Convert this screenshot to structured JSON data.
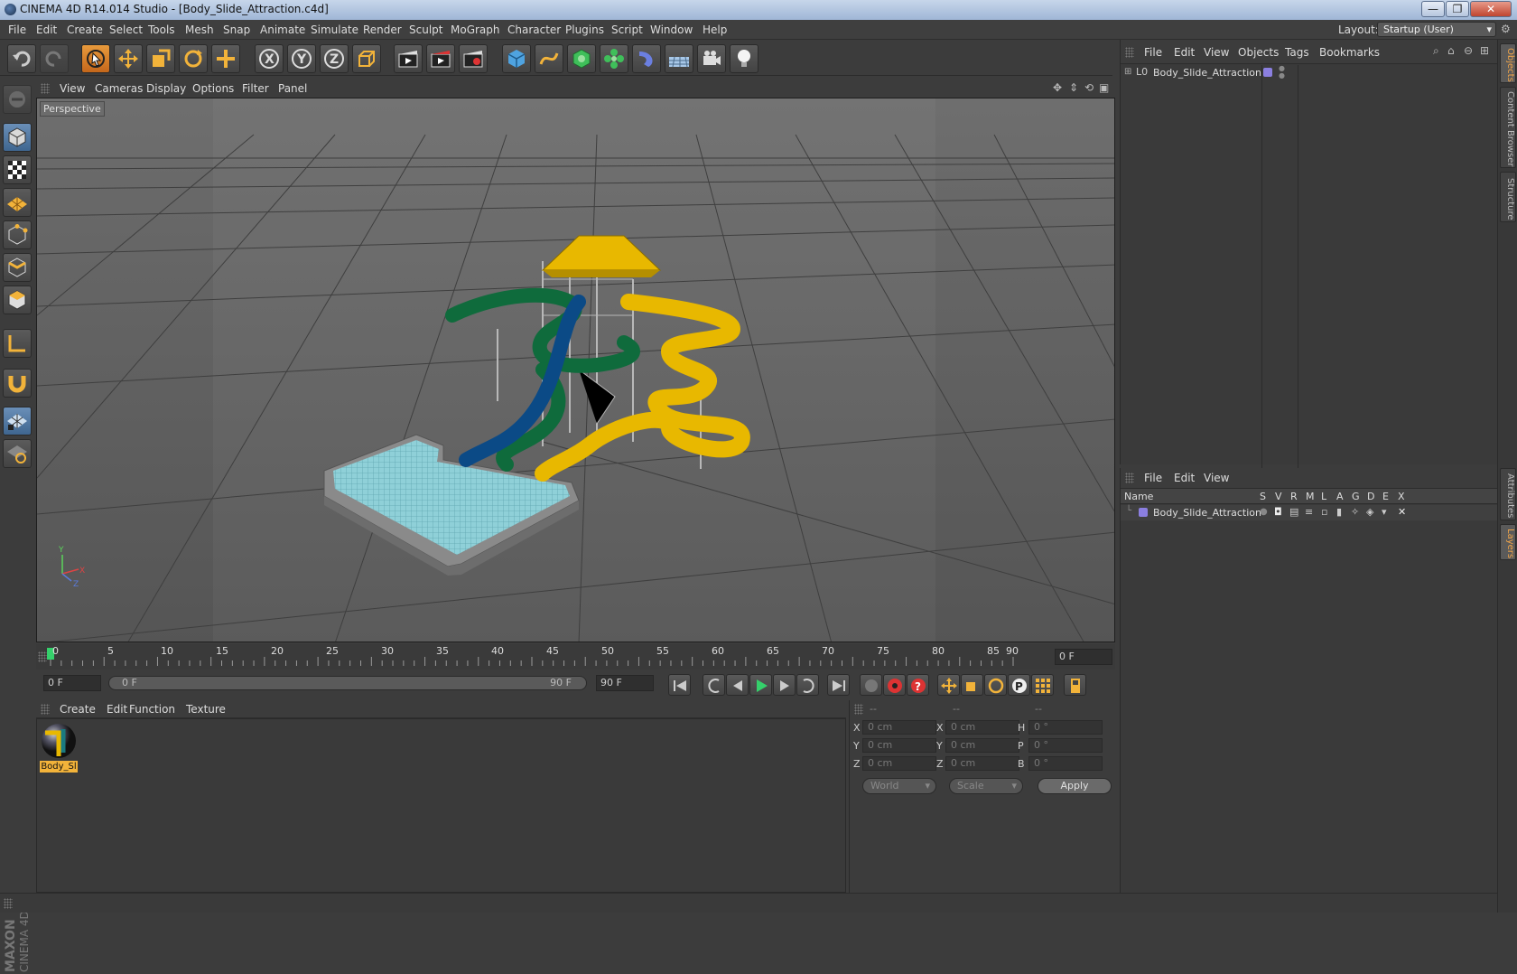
{
  "window": {
    "title": "CINEMA 4D R14.014 Studio - [Body_Slide_Attraction.c4d]",
    "min": "—",
    "max": "❐",
    "close": "✕"
  },
  "menubar": {
    "items": [
      "File",
      "Edit",
      "Create",
      "Select",
      "Tools",
      "Mesh",
      "Snap",
      "Animate",
      "Simulate",
      "Render",
      "Sculpt",
      "MoGraph",
      "Character",
      "Plugins",
      "Script",
      "Window",
      "Help"
    ],
    "layout_label": "Layout:",
    "layout_value": "Startup (User)"
  },
  "viewport": {
    "menu": [
      "View",
      "Cameras",
      "Display",
      "Options",
      "Filter",
      "Panel"
    ],
    "label": "Perspective",
    "axis_x": "X",
    "axis_y": "Y",
    "axis_z": "Z"
  },
  "timeline": {
    "ticks": [
      "0",
      "5",
      "10",
      "15",
      "20",
      "25",
      "30",
      "35",
      "40",
      "45",
      "50",
      "55",
      "60",
      "65",
      "70",
      "75",
      "80",
      "85",
      "90"
    ],
    "current_frame": "0 F",
    "start_field": "0 F",
    "range_start": "0 F",
    "range_end": "90 F",
    "end_field": "90 F"
  },
  "materials": {
    "menu": [
      "Create",
      "Edit",
      "Function",
      "Texture"
    ],
    "items": [
      {
        "label": "Body_Sl"
      }
    ]
  },
  "coordinates": {
    "head1": "--",
    "head2": "--",
    "head3": "--",
    "rows": [
      {
        "a": "X",
        "av": "0 cm",
        "b": "X",
        "bv": "0 cm",
        "c": "H",
        "cv": "0 °"
      },
      {
        "a": "Y",
        "av": "0 cm",
        "b": "Y",
        "bv": "0 cm",
        "c": "P",
        "cv": "0 °"
      },
      {
        "a": "Z",
        "av": "0 cm",
        "b": "Z",
        "bv": "0 cm",
        "c": "B",
        "cv": "0 °"
      }
    ],
    "mode": "World",
    "scale": "Scale",
    "apply": "Apply"
  },
  "objects": {
    "menu": [
      "File",
      "Edit",
      "View",
      "Objects",
      "Tags",
      "Bookmarks"
    ],
    "items": [
      {
        "name": "Body_Slide_Attraction"
      }
    ]
  },
  "layers": {
    "menu": [
      "File",
      "Edit",
      "View"
    ],
    "headers": [
      "Name",
      "S",
      "V",
      "R",
      "M",
      "L",
      "A",
      "G",
      "D",
      "E",
      "X"
    ],
    "items": [
      {
        "name": "Body_Slide_Attraction",
        "color": "#8b7fe0"
      }
    ]
  },
  "side_tabs": {
    "top": [
      "Objects",
      "Content Browser",
      "Structure"
    ],
    "bottom": [
      "Attributes",
      "Layers"
    ]
  },
  "branding": {
    "line1": "MAXON",
    "line2": "CINEMA 4D"
  },
  "colors": {
    "accent": "#e89a3c",
    "layer": "#8b7fe0",
    "slide_yellow": "#e8b800",
    "slide_green": "#0f6b3c",
    "slide_blue": "#0b4a86",
    "water": "#8fd0d8"
  }
}
